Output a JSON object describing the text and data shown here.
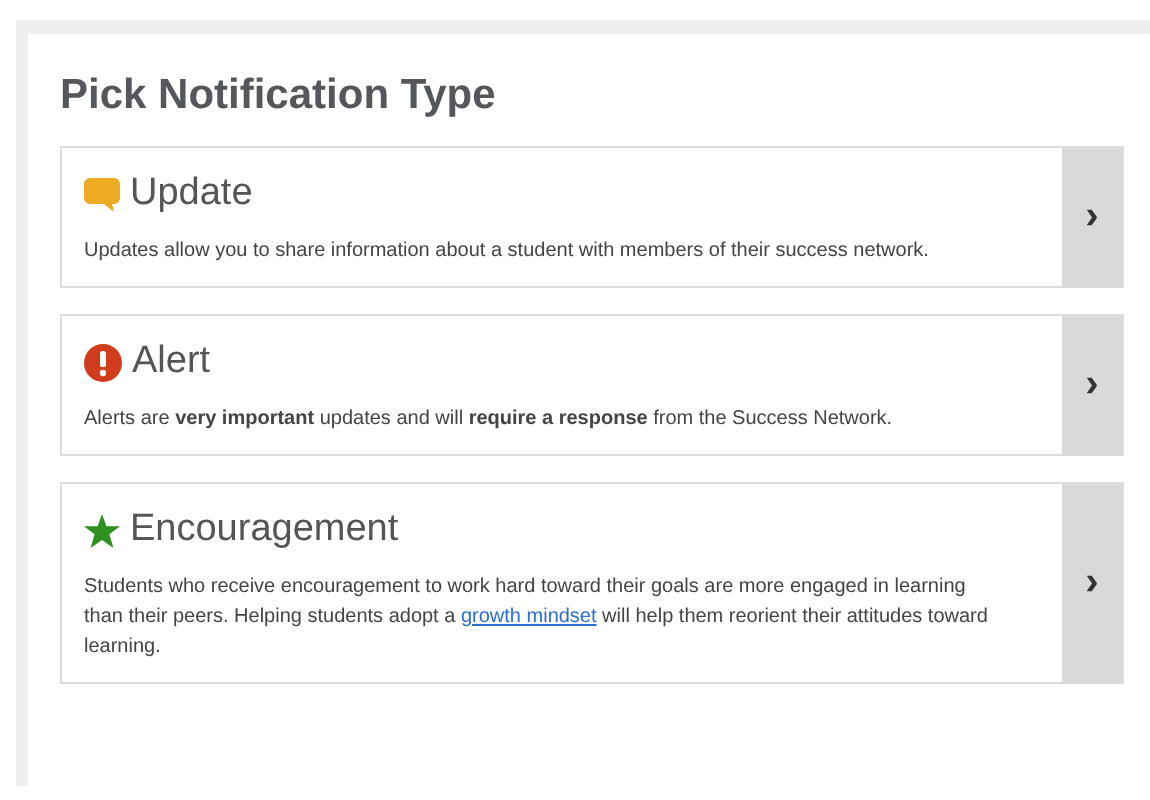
{
  "title": "Pick Notification Type",
  "options": [
    {
      "kind": "speech",
      "name": "Update",
      "description": [
        {
          "text": "Updates allow you to share information about a student with members of their success network."
        }
      ]
    },
    {
      "kind": "alert",
      "name": "Alert",
      "description": [
        {
          "text": "Alerts are **very important** updates and will **require a response** from the Success Network."
        }
      ]
    },
    {
      "kind": "star",
      "name": "Encouragement",
      "description": [
        {
          "text": "Students who receive encouragement to work hard toward their goals are more engaged in learning than their peers. Helping students adopt a "
        },
        {
          "text": "growth mindset",
          "link": true
        },
        {
          "text": " will help them reorient their attitudes toward learning."
        }
      ]
    }
  ],
  "chevron": "›"
}
